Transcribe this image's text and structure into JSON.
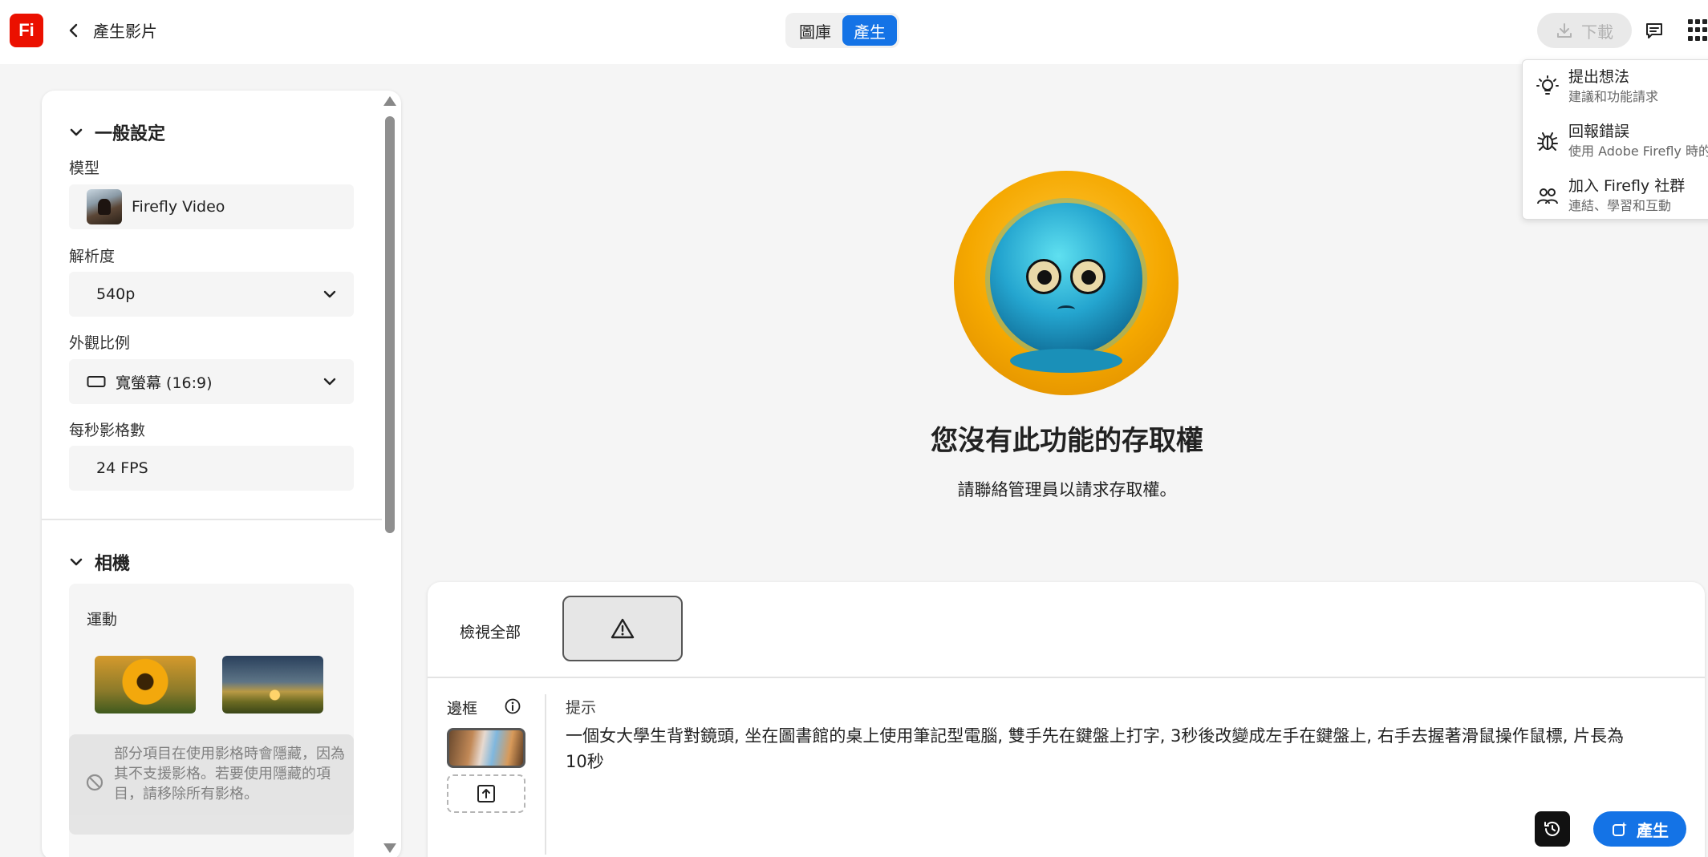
{
  "app": {
    "logo_text": "Fi",
    "brand_color": "#eb1000",
    "accent_color": "#1473e6"
  },
  "header": {
    "page_title": "產生影片",
    "tabs": [
      {
        "label": "圖庫",
        "active": false
      },
      {
        "label": "產生",
        "active": true
      }
    ],
    "download_label": "下載"
  },
  "menu": {
    "items": [
      {
        "title": "提出想法",
        "subtitle": "建議和功能請求",
        "icon": "lightbulb-icon"
      },
      {
        "title": "回報錯誤",
        "subtitle": "使用 Adobe Firefly 時的",
        "icon": "bug-icon"
      },
      {
        "title": "加入 Firefly 社群",
        "subtitle": "連結、學習和互動",
        "icon": "community-icon"
      }
    ]
  },
  "settings": {
    "general_title": "一般設定",
    "model_label": "模型",
    "model_value": "Firefly Video",
    "resolution_label": "解析度",
    "resolution_value": "540p",
    "aspect_label": "外觀比例",
    "aspect_value": "寬螢幕 (16:9)",
    "fps_label": "每秒影格數",
    "fps_value": "24 FPS",
    "camera_title": "相機",
    "motion_label": "運動",
    "hidden_note": "部分項目在使用影格時會隱藏，因為其不支援影格。若要使用隱藏的項目，請移除所有影格。"
  },
  "main": {
    "no_access_title": "您沒有此功能的存取權",
    "no_access_subtitle": "請聯絡管理員以請求存取權。"
  },
  "prompt_panel": {
    "view_all_label": "檢視全部",
    "frame_label": "邊框",
    "prompt_label": "提示",
    "prompt_text": "一個女大學生背對鏡頭, 坐在圖書館的桌上使用筆記型電腦, 雙手先在鍵盤上打字, 3秒後改變成左手在鍵盤上, 右手去握著滑鼠操作鼠標, 片長為10秒",
    "generate_label": "產生"
  }
}
